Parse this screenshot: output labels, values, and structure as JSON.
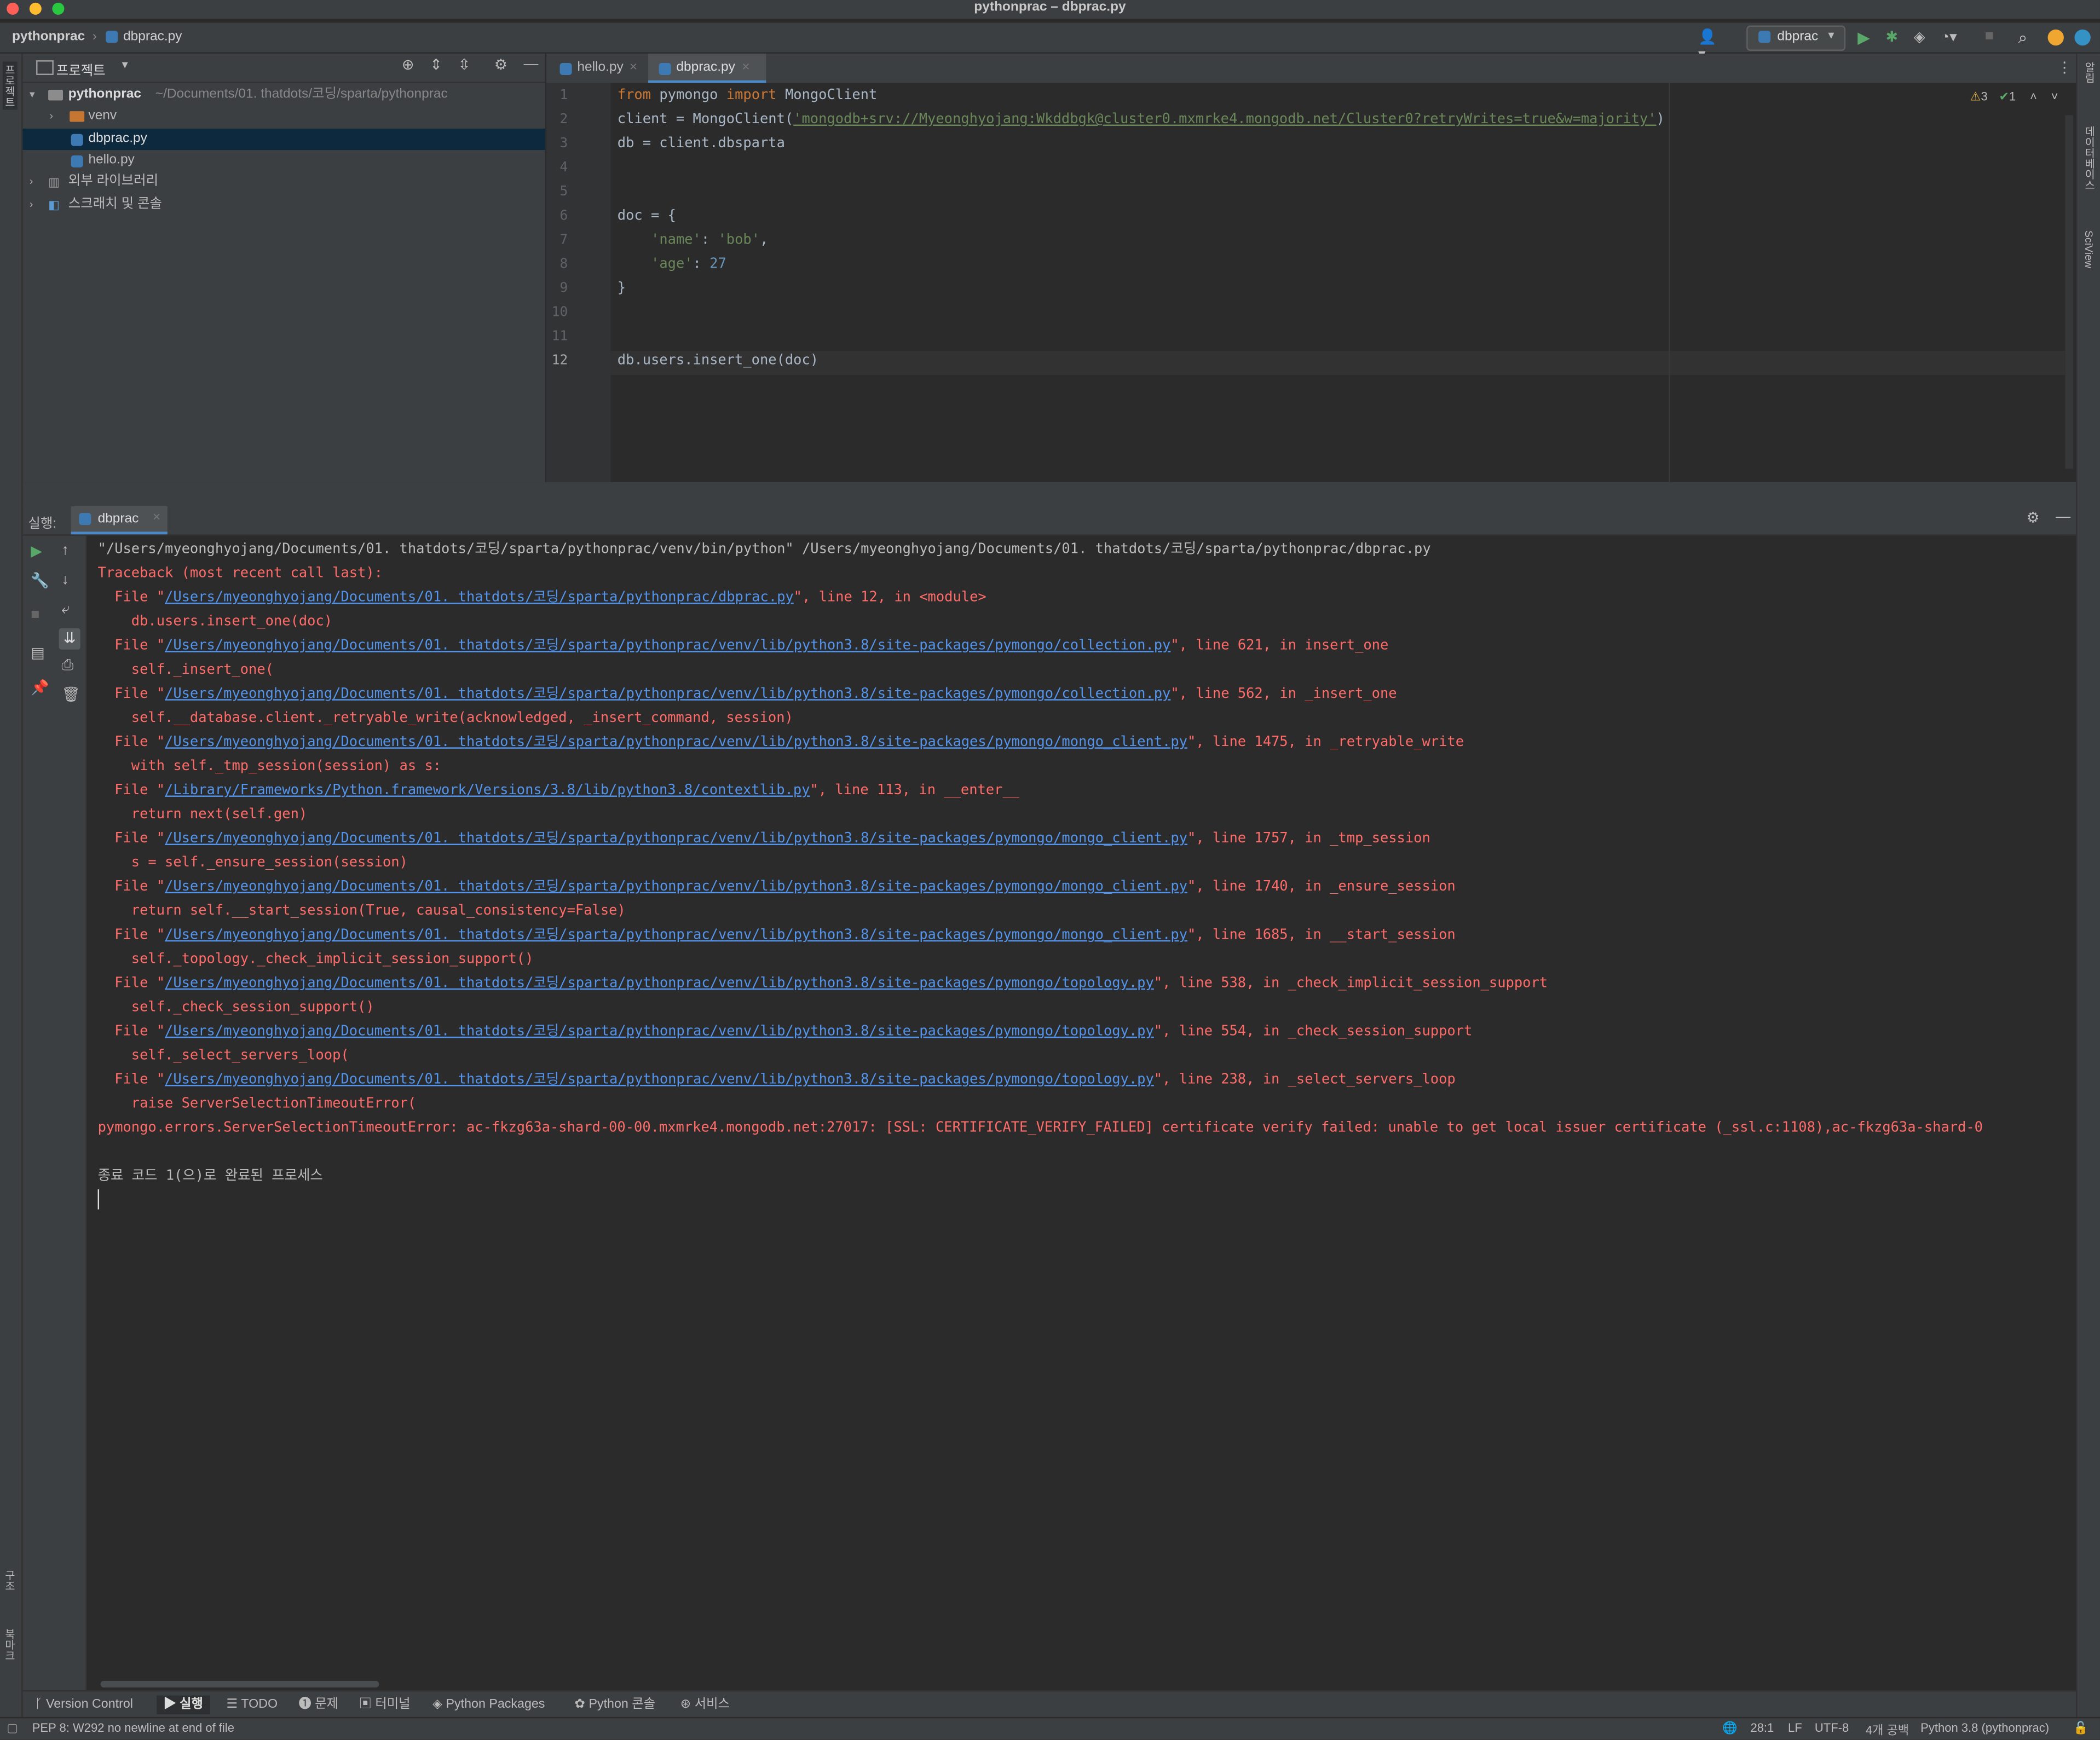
{
  "window": {
    "title": "pythonprac – dbprac.py"
  },
  "navbar": {
    "project": "pythonprac",
    "file": "dbprac.py",
    "run_config": "dbprac"
  },
  "left_stripe": {
    "project_label": "프로젝트",
    "structure_label": "구조",
    "bookmarks_label": "북마크"
  },
  "right_stripe": {
    "notifications_label": "알림",
    "database_label": "데이터베이스",
    "sciview_label": "SciView"
  },
  "project_panel": {
    "title": "프로젝트",
    "tree": [
      {
        "label": "pythonprac",
        "path": "~/Documents/01. thatdots/코딩/sparta/pythonprac"
      },
      {
        "label": "venv"
      },
      {
        "label": "dbprac.py"
      },
      {
        "label": "hello.py"
      },
      {
        "label": "외부 라이브러리"
      },
      {
        "label": "스크래치 및 콘솔"
      }
    ]
  },
  "editor": {
    "tabs": [
      {
        "label": "hello.py"
      },
      {
        "label": "dbprac.py"
      }
    ],
    "inspections": {
      "warnings": "3",
      "ok": "1"
    },
    "line_numbers": [
      "1",
      "2",
      "3",
      "4",
      "5",
      "6",
      "7",
      "8",
      "9",
      "10",
      "11",
      "12"
    ],
    "code": {
      "l1_kw1": "from",
      "l1_mod": " pymongo ",
      "l1_kw2": "import",
      "l1_rest": " MongoClient",
      "l2_a": "client = MongoClient(",
      "l2_str": "'mongodb+srv://Myeonghyojang:Wkddbgk@cluster0.mxmrke4.mongodb.net/Cluster0?retryWrites=true&w=majority'",
      "l2_b": ")",
      "l3": "db = client.dbsparta",
      "l6": "doc = {",
      "l7_key": "'name'",
      "l7_mid": ": ",
      "l7_val": "'bob'",
      "l7_end": ",",
      "l8_key": "'age'",
      "l8_mid": ": ",
      "l8_val": "27",
      "l9": "}",
      "l12": "db.users.insert_one(doc)"
    }
  },
  "run_panel": {
    "label": "실행:",
    "tab": "dbprac",
    "console": {
      "cmd": "\"/Users/myeonghyojang/Documents/01. thatdots/코딩/sparta/pythonprac/venv/bin/python\" /Users/myeonghyojang/Documents/01. thatdots/코딩/sparta/pythonprac/dbprac.py",
      "traceback": "Traceback (most recent call last):",
      "frames": [
        {
          "prefix": "  File \"",
          "path": "/Users/myeonghyojang/Documents/01. thatdots/코딩/sparta/pythonprac/dbprac.py",
          "suffix": "\", line 12, in <module>",
          "code": "    db.users.insert_one(doc)"
        },
        {
          "prefix": "  File \"",
          "path": "/Users/myeonghyojang/Documents/01. thatdots/코딩/sparta/pythonprac/venv/lib/python3.8/site-packages/pymongo/collection.py",
          "suffix": "\", line 621, in insert_one",
          "code": "    self._insert_one("
        },
        {
          "prefix": "  File \"",
          "path": "/Users/myeonghyojang/Documents/01. thatdots/코딩/sparta/pythonprac/venv/lib/python3.8/site-packages/pymongo/collection.py",
          "suffix": "\", line 562, in _insert_one",
          "code": "    self.__database.client._retryable_write(acknowledged, _insert_command, session)"
        },
        {
          "prefix": "  File \"",
          "path": "/Users/myeonghyojang/Documents/01. thatdots/코딩/sparta/pythonprac/venv/lib/python3.8/site-packages/pymongo/mongo_client.py",
          "suffix": "\", line 1475, in _retryable_write",
          "code": "    with self._tmp_session(session) as s:"
        },
        {
          "prefix": "  File \"",
          "path": "/Library/Frameworks/Python.framework/Versions/3.8/lib/python3.8/contextlib.py",
          "suffix": "\", line 113, in __enter__",
          "code": "    return next(self.gen)"
        },
        {
          "prefix": "  File \"",
          "path": "/Users/myeonghyojang/Documents/01. thatdots/코딩/sparta/pythonprac/venv/lib/python3.8/site-packages/pymongo/mongo_client.py",
          "suffix": "\", line 1757, in _tmp_session",
          "code": "    s = self._ensure_session(session)"
        },
        {
          "prefix": "  File \"",
          "path": "/Users/myeonghyojang/Documents/01. thatdots/코딩/sparta/pythonprac/venv/lib/python3.8/site-packages/pymongo/mongo_client.py",
          "suffix": "\", line 1740, in _ensure_session",
          "code": "    return self.__start_session(True, causal_consistency=False)"
        },
        {
          "prefix": "  File \"",
          "path": "/Users/myeonghyojang/Documents/01. thatdots/코딩/sparta/pythonprac/venv/lib/python3.8/site-packages/pymongo/mongo_client.py",
          "suffix": "\", line 1685, in __start_session",
          "code": "    self._topology._check_implicit_session_support()"
        },
        {
          "prefix": "  File \"",
          "path": "/Users/myeonghyojang/Documents/01. thatdots/코딩/sparta/pythonprac/venv/lib/python3.8/site-packages/pymongo/topology.py",
          "suffix": "\", line 538, in _check_implicit_session_support",
          "code": "    self._check_session_support()"
        },
        {
          "prefix": "  File \"",
          "path": "/Users/myeonghyojang/Documents/01. thatdots/코딩/sparta/pythonprac/venv/lib/python3.8/site-packages/pymongo/topology.py",
          "suffix": "\", line 554, in _check_session_support",
          "code": "    self._select_servers_loop("
        },
        {
          "prefix": "  File \"",
          "path": "/Users/myeonghyojang/Documents/01. thatdots/코딩/sparta/pythonprac/venv/lib/python3.8/site-packages/pymongo/topology.py",
          "suffix": "\", line 238, in _select_servers_loop",
          "code": "    raise ServerSelectionTimeoutError("
        }
      ],
      "error": "pymongo.errors.ServerSelectionTimeoutError: ac-fkzg63a-shard-00-00.mxmrke4.mongodb.net:27017: [SSL: CERTIFICATE_VERIFY_FAILED] certificate verify failed: unable to get local issuer certificate (_ssl.c:1108),ac-fkzg63a-shard-0",
      "exit": "종료 코드 1(으)로 완료된 프로세스"
    }
  },
  "tool_tabs": [
    "Version Control",
    "실행",
    "TODO",
    "문제",
    "터미널",
    "Python Packages",
    "Python 콘솔",
    "서비스"
  ],
  "status": {
    "message": "PEP 8: W292 no newline at end of file",
    "position": "28:1",
    "line_sep": "LF",
    "encoding": "UTF-8",
    "indent": "4개 공백",
    "interpreter": "Python 3.8 (pythonprac)"
  },
  "colors": {
    "background": "#2b2b2b",
    "panel": "#3c3f41",
    "error_text": "#ff6b68",
    "link": "#5394ec",
    "selection": "#0d293e"
  }
}
